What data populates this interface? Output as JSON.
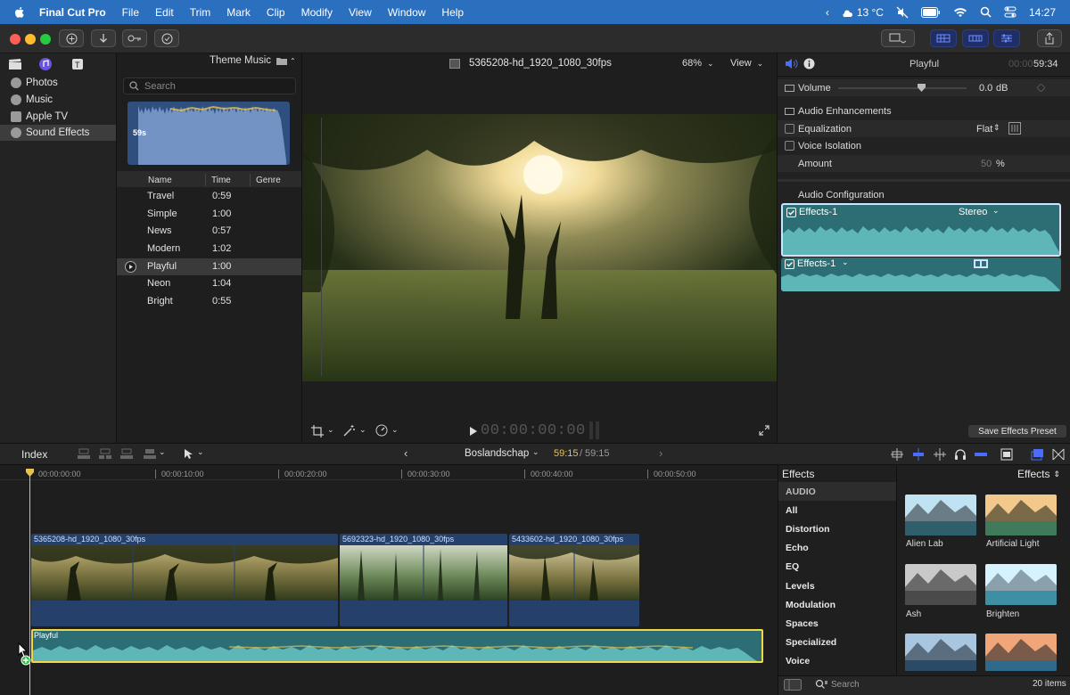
{
  "menubar": {
    "app": "Final Cut Pro",
    "items": [
      "File",
      "Edit",
      "Trim",
      "Mark",
      "Clip",
      "Modify",
      "View",
      "Window",
      "Help"
    ],
    "weather": "13 °C",
    "clock": "14:27"
  },
  "sidebar": {
    "items": [
      {
        "label": "Photos"
      },
      {
        "label": "Music"
      },
      {
        "label": "Apple TV"
      },
      {
        "label": "Sound Effects"
      }
    ]
  },
  "browser": {
    "source": "Theme Music",
    "search_placeholder": "Search",
    "preview_duration": "59s",
    "columns": {
      "name": "Name",
      "time": "Time",
      "genre": "Genre"
    },
    "rows": [
      {
        "name": "Travel",
        "time": "0:59"
      },
      {
        "name": "Simple",
        "time": "1:00"
      },
      {
        "name": "News",
        "time": "0:57"
      },
      {
        "name": "Modern",
        "time": "1:02"
      },
      {
        "name": "Playful",
        "time": "1:00"
      },
      {
        "name": "Neon",
        "time": "1:04"
      },
      {
        "name": "Bright",
        "time": "0:55"
      }
    ]
  },
  "viewer": {
    "clip_name": "5365208-hd_1920_1080_30fps",
    "zoom": "68%",
    "view_label": "View",
    "timecode": "00:00:00:00"
  },
  "inspector": {
    "title": "Playful",
    "time_dim": "00:00",
    "time": "59:34",
    "volume_label": "Volume",
    "volume_value": "0.0",
    "volume_unit": "dB",
    "enhancements_label": "Audio Enhancements",
    "equalization_label": "Equalization",
    "equalization_value": "Flat",
    "voice_isolation_label": "Voice Isolation",
    "amount_label": "Amount",
    "amount_value": "50",
    "amount_unit": "%",
    "config_label": "Audio Configuration",
    "channel1_name": "Effects-1",
    "channel1_mode": "Stereo",
    "channel2_name": "Effects-1",
    "save_preset": "Save Effects Preset"
  },
  "timeline": {
    "index_label": "Index",
    "project": "Boslandschap",
    "position": "59:15",
    "duration": "59:15",
    "ruler": [
      "00:00:00:00",
      "00:00:10:00",
      "00:00:20:00",
      "00:00:30:00",
      "00:00:40:00",
      "00:00:50:00"
    ],
    "clips": [
      {
        "name": "5365208-hd_1920_1080_30fps"
      },
      {
        "name": "5692323-hd_1920_1080_30fps"
      },
      {
        "name": "5433602-hd_1920_1080_30fps"
      }
    ],
    "audio_clip": "Playful"
  },
  "effects": {
    "title": "Effects",
    "selector": "Effects",
    "categories": [
      "AUDIO",
      "All",
      "Distortion",
      "Echo",
      "EQ",
      "Levels",
      "Modulation",
      "Spaces",
      "Specialized",
      "Voice"
    ],
    "items": [
      {
        "label": "Alien Lab"
      },
      {
        "label": "Artificial Light"
      },
      {
        "label": "Ash"
      },
      {
        "label": "Brighten"
      }
    ],
    "search_placeholder": "Search",
    "count": "20 items"
  },
  "colors": {
    "accent": "#2b6fbf",
    "audio_clip": "#3a9c9c",
    "selection": "#f1d64a",
    "video_clip": "#25406b"
  }
}
